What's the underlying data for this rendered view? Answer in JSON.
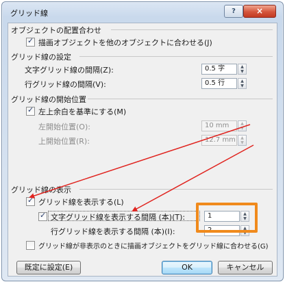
{
  "dialog": {
    "title": "グリッド線",
    "help_label": "?",
    "close_label": "×"
  },
  "object_alignment": {
    "heading": "オブジェクトの配置合わせ",
    "checkbox_label": "描画オブジェクトを他のオブジェクトに合わせる(J)",
    "checked": true
  },
  "grid_settings": {
    "heading": "グリッド線の設定",
    "char_spacing_label": "文字グリッド線の間隔(Z):",
    "char_spacing_value": "0.5 字",
    "line_spacing_label": "行グリッド線の間隔(V):",
    "line_spacing_value": "0.5 行"
  },
  "grid_origin": {
    "heading": "グリッド線の開始位置",
    "use_margins_label": "左上余白を基準にする(M)",
    "use_margins_checked": true,
    "horizontal_label": "左開始位置(O):",
    "horizontal_value": "10 mm",
    "vertical_label": "上開始位置(R):",
    "vertical_value": "12.7 mm"
  },
  "grid_display": {
    "heading": "グリッド線の表示",
    "show_grid_label": "グリッド線を表示する(L)",
    "show_grid_checked": true,
    "show_char_grid_label": "文字グリッド線を表示する間隔 (本)(T):",
    "show_char_grid_checked": true,
    "char_interval_value": "1",
    "line_interval_label": "行グリッド線を表示する間隔 (本)(I):",
    "line_interval_value": "2",
    "hide_when_off_label": "グリッド線が非表示のときに描画オブジェクトをグリッド線に合わせる(G)",
    "hide_when_off_checked": false
  },
  "buttons": {
    "set_default": "既定に設定(E)",
    "ok": "OK",
    "cancel": "キャンセル"
  },
  "annotation": {
    "highlight_color": "#f08a1c",
    "arrow_color": "#e0241f"
  }
}
